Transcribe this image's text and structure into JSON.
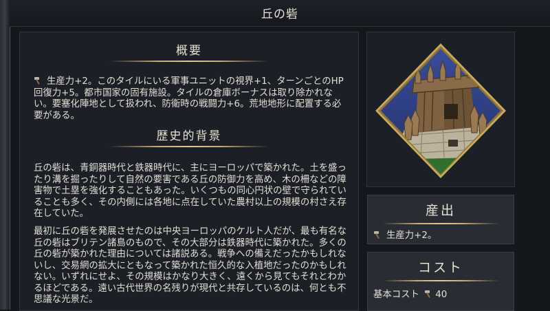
{
  "window": {
    "title": "丘の砦"
  },
  "overview": {
    "heading": "概要",
    "icon": "production-hammer-icon",
    "text": "生産力+2。このタイルにいる軍事ユニットの視界+1、ターンごとのHP回復力+5。都市国家の固有施設。タイルの倉庫ボーナスは取り除かれない。要塞化陣地として扱われ、防衛時の戦闘力+6。荒地地形に配置する必要がある。"
  },
  "history": {
    "heading": "歴史的背景",
    "paragraph1": "丘の砦は、青銅器時代と鉄器時代に、主にヨーロッパで築かれた。土を盛ったり溝を掘ったりして自然の要害である丘の防御力を高め、木の柵などの障害物で土塁を強化することもあった。いくつもの同心円状の壁で守られていることも多く、その内側には各地に点在していた農村以上の規模の村さえ存在していた。",
    "paragraph2": "最初に丘の砦を発展させたのは中央ヨーロッパのケルト人だが、最も有名な丘の砦はブリテン諸島のもので、その大部分は鉄器時代に築かれた。多くの丘の砦が築かれた理由については諸説ある。戦争への備えだったかもしれないし、交易網の拡大にともなって築かれた恒久的な入植地だったのかもしれない。いずれにせよ、その規模はかなり大きく、遠くから見てもそれとわかるほどである。遠い古代世界の名残りが現代と共存しているのは、何とも不思議な光景だ。"
  },
  "emblem": {
    "icon": "hill-fort-emblem-icon",
    "colors": {
      "frame": "#c9a95a",
      "sky": "#2f3f86",
      "grass": "#3e8c3a"
    }
  },
  "yield": {
    "heading": "産出",
    "icon": "production-hammer-icon",
    "text": "生産力+2。"
  },
  "cost": {
    "heading": "コスト",
    "label": "基本コスト",
    "icon": "production-hammer-icon",
    "value": "40"
  }
}
